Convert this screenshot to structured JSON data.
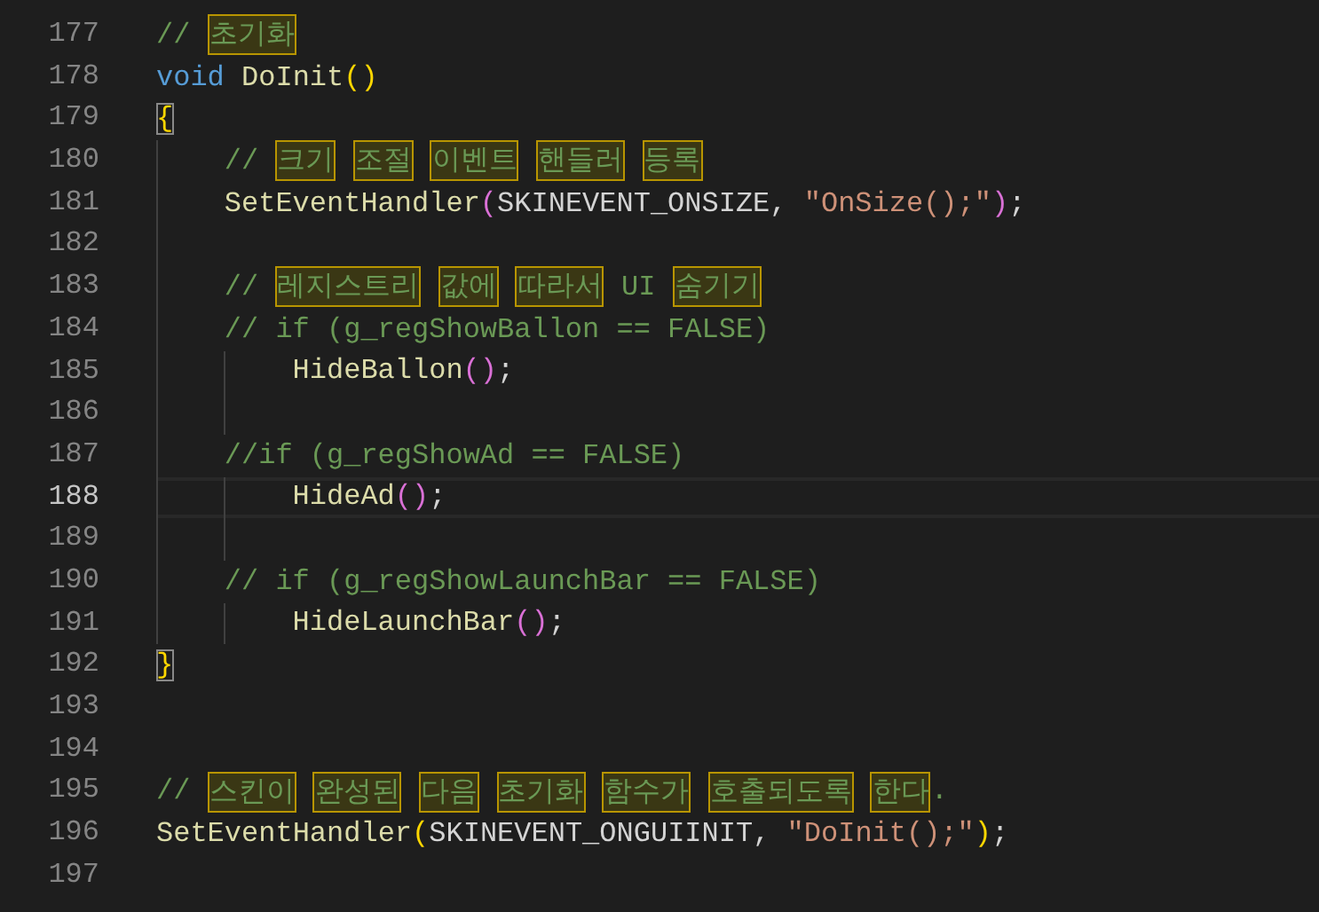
{
  "editor": {
    "lines": [
      {
        "n": "177",
        "current": false,
        "tokens": [
          {
            "kind": "comment",
            "t": "// "
          },
          {
            "kind": "flagged",
            "t": "초기화"
          }
        ]
      },
      {
        "n": "178",
        "current": false,
        "tokens": [
          {
            "kind": "keyword",
            "t": "void "
          },
          {
            "kind": "function",
            "t": "DoInit"
          },
          {
            "kind": "bracket1",
            "t": "()"
          }
        ]
      },
      {
        "n": "179",
        "current": false,
        "tokens": [
          {
            "kind": "brace-matched",
            "t": "{"
          }
        ],
        "children": [
          {
            "n": "180",
            "current": false,
            "tokens": [
              {
                "kind": "comment",
                "t": "// "
              },
              {
                "kind": "flagged",
                "t": "크기"
              },
              {
                "kind": "flagged",
                "t": "조절"
              },
              {
                "kind": "flagged",
                "t": "이벤트"
              },
              {
                "kind": "flagged",
                "t": "핸들러"
              },
              {
                "kind": "flagged",
                "t": "등록"
              }
            ]
          },
          {
            "n": "181",
            "current": false,
            "tokens": [
              {
                "kind": "function",
                "t": "SetEventHandler"
              },
              {
                "kind": "bracket2",
                "t": "("
              },
              {
                "kind": "plain",
                "t": "SKINEVENT_ONSIZE, "
              },
              {
                "kind": "string",
                "t": "\"OnSize();\""
              },
              {
                "kind": "bracket2",
                "t": ")"
              },
              {
                "kind": "plain",
                "t": ";"
              }
            ]
          },
          {
            "n": "182",
            "current": false
          },
          {
            "n": "183",
            "current": false,
            "tokens": [
              {
                "kind": "comment",
                "t": "// "
              },
              {
                "kind": "flagged",
                "t": "레지스트리"
              },
              {
                "kind": "flagged",
                "t": "값에"
              },
              {
                "kind": "flagged",
                "t": "따라서"
              },
              {
                "kind": "comment",
                "t": " UI "
              },
              {
                "kind": "flagged",
                "t": "숨기기"
              }
            ]
          },
          {
            "n": "184",
            "current": false,
            "tokens": [
              {
                "kind": "comment",
                "t": "// if (g_regShowBallon == FALSE)"
              }
            ],
            "children": [
              {
                "n": "185",
                "current": false,
                "tokens": [
                  {
                    "kind": "function",
                    "t": "HideBallon"
                  },
                  {
                    "kind": "bracket2",
                    "t": "()"
                  },
                  {
                    "kind": "plain",
                    "t": ";"
                  }
                ]
              },
              {
                "n": "186",
                "current": false
              }
            ]
          },
          {
            "n": "187",
            "current": false,
            "tokens": [
              {
                "kind": "comment",
                "t": "//if (g_regShowAd == FALSE)"
              }
            ],
            "children": [
              {
                "n": "188",
                "current": true,
                "tokens": [
                  {
                    "kind": "function",
                    "t": "HideAd"
                  },
                  {
                    "kind": "bracket2",
                    "t": "()"
                  },
                  {
                    "kind": "plain",
                    "t": ";"
                  }
                ]
              },
              {
                "n": "189",
                "current": false
              }
            ]
          },
          {
            "n": "190",
            "current": false,
            "tokens": [
              {
                "kind": "comment",
                "t": "// if (g_regShowLaunchBar == FALSE)"
              }
            ],
            "children": [
              {
                "n": "191",
                "current": false,
                "tokens": [
                  {
                    "kind": "function",
                    "t": "HideLaunchBar"
                  },
                  {
                    "kind": "bracket2",
                    "t": "()"
                  },
                  {
                    "kind": "plain",
                    "t": ";"
                  }
                ]
              }
            ]
          }
        ]
      },
      {
        "n": "192",
        "current": false,
        "tokens": [
          {
            "kind": "brace-matched",
            "t": "}"
          }
        ]
      },
      {
        "n": "193",
        "current": false
      },
      {
        "n": "194",
        "current": false
      },
      {
        "n": "195",
        "current": false,
        "tokens": [
          {
            "kind": "comment",
            "t": "// "
          },
          {
            "kind": "flagged",
            "t": "스킨이"
          },
          {
            "kind": "flagged",
            "t": "완성된"
          },
          {
            "kind": "flagged",
            "t": "다음"
          },
          {
            "kind": "flagged",
            "t": "초기화"
          },
          {
            "kind": "flagged",
            "t": "함수가"
          },
          {
            "kind": "flagged",
            "t": "호출되도록"
          },
          {
            "kind": "flagged",
            "t": "한다"
          },
          {
            "kind": "comment",
            "t": "."
          }
        ]
      },
      {
        "n": "196",
        "current": false,
        "tokens": [
          {
            "kind": "function",
            "t": "SetEventHandler"
          },
          {
            "kind": "bracket1",
            "t": "("
          },
          {
            "kind": "plain",
            "t": "SKINEVENT_ONGUIINIT, "
          },
          {
            "kind": "string",
            "t": "\"DoInit();\""
          },
          {
            "kind": "bracket1",
            "t": ")"
          },
          {
            "kind": "plain",
            "t": ";"
          }
        ]
      },
      {
        "n": "197",
        "current": false
      }
    ]
  }
}
